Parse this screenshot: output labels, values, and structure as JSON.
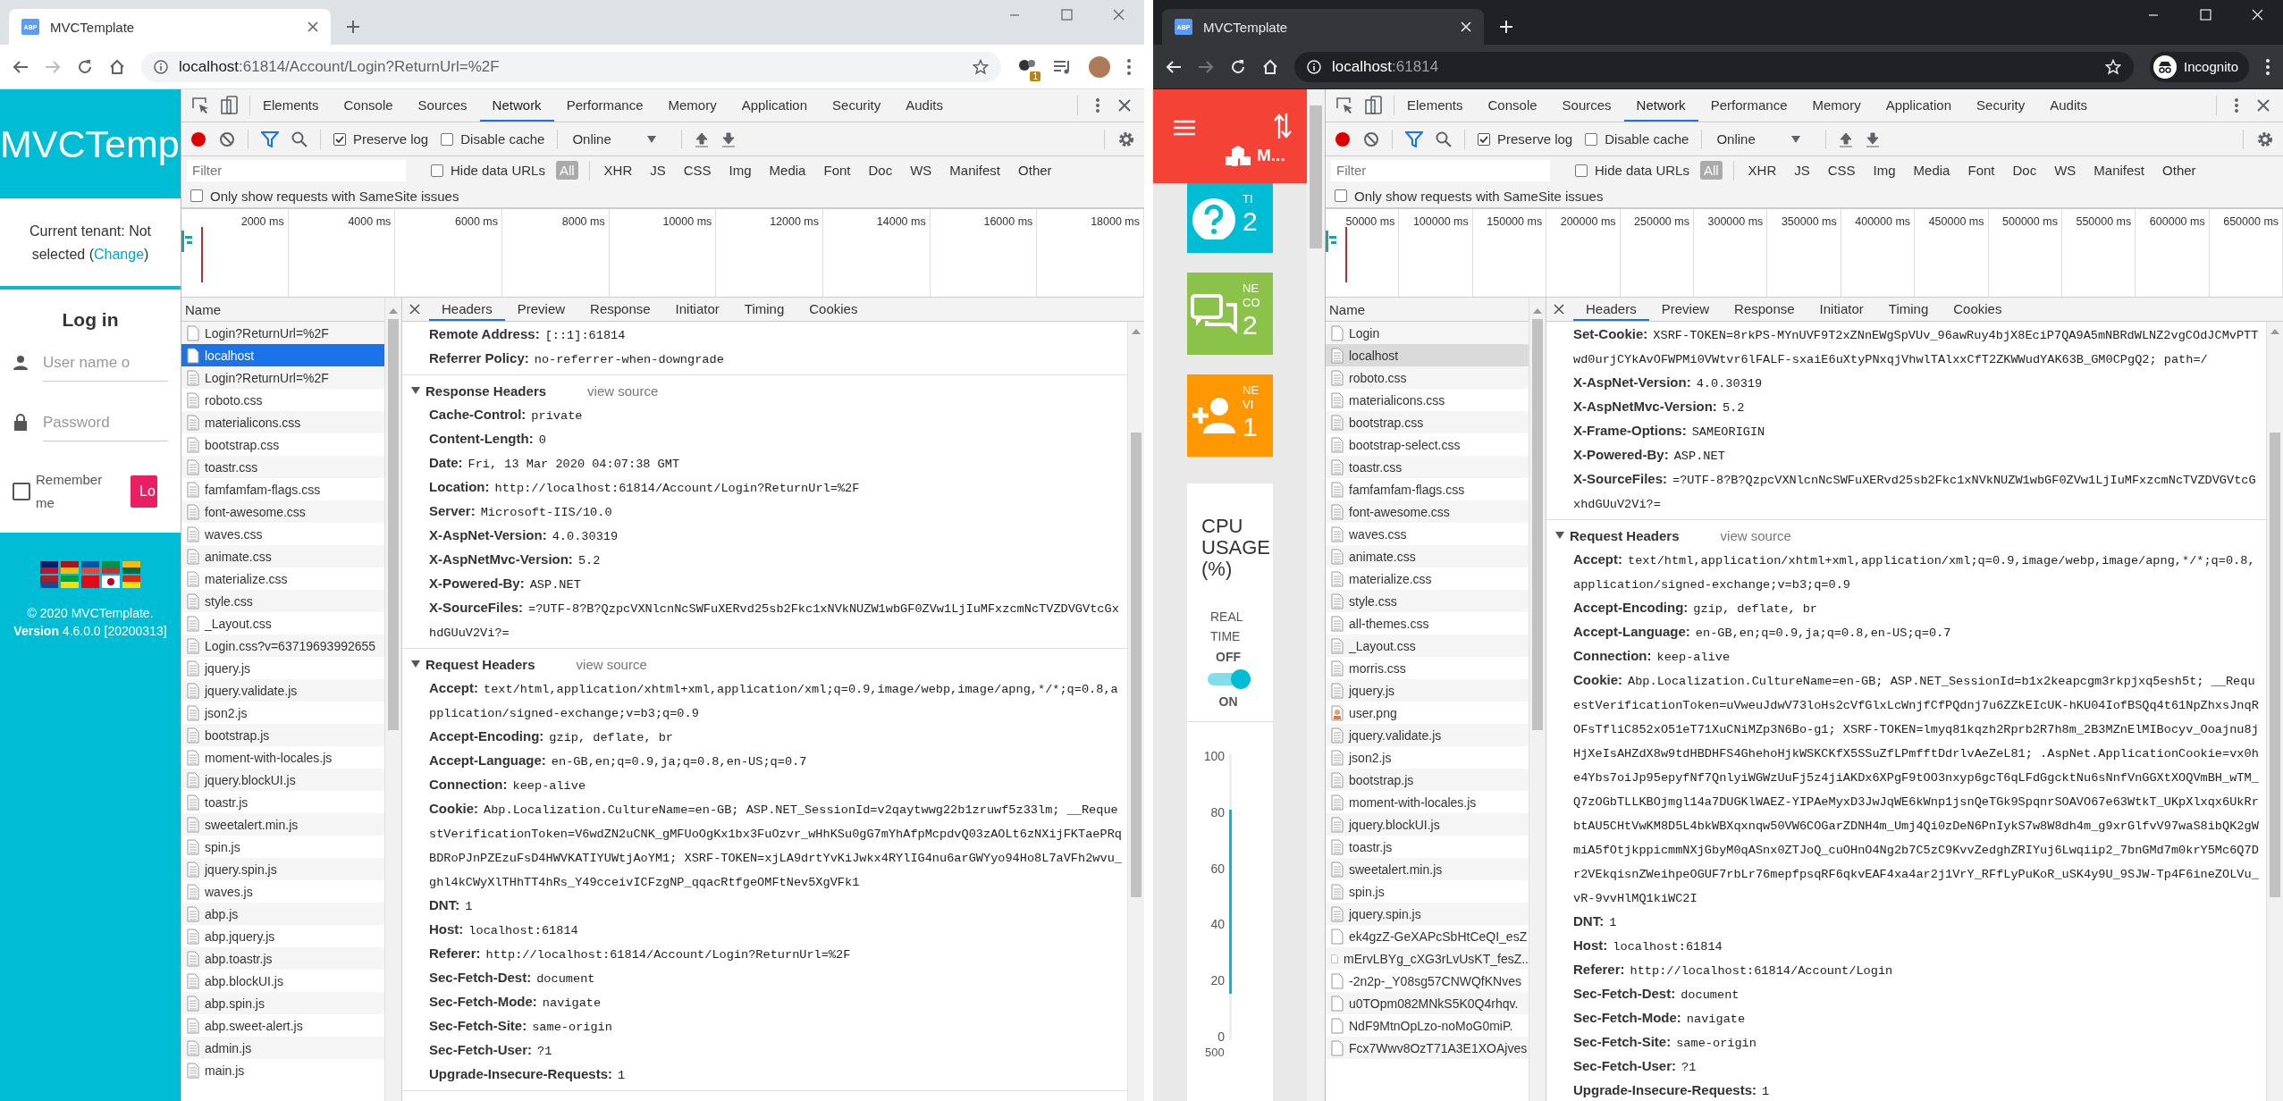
{
  "windows": [
    {
      "incognito": false,
      "tab": {
        "favicon_text": "ABP",
        "title": "MVCTemplate"
      },
      "url_host": "localhost",
      "url_rest": ":61814/Account/Login?ReturnUrl=%2F",
      "extension_badge": "1",
      "app": {
        "kind": "login",
        "brand": "MVCTemp",
        "tenant_prefix": "Current tenant: Not selected (",
        "tenant_link": "Change",
        "tenant_suffix": ")",
        "title": "Log in",
        "username_placeholder": "User name o",
        "password_placeholder": "Password",
        "remember": {
          "label": "Remember me",
          "checked": false
        },
        "login_button": "Lo",
        "copyright": "© 2020 MVCTemplate.",
        "version_label": "Version",
        "version": "4.6.0.0 [20200313]"
      },
      "devtools": {
        "panel_tabs": [
          {
            "label": "Elements",
            "selected": false
          },
          {
            "label": "Console",
            "selected": false
          },
          {
            "label": "Sources",
            "selected": false
          },
          {
            "label": "Network",
            "selected": true
          },
          {
            "label": "Performance",
            "selected": false
          },
          {
            "label": "Memory",
            "selected": false
          },
          {
            "label": "Application",
            "selected": false
          },
          {
            "label": "Security",
            "selected": false
          },
          {
            "label": "Audits",
            "selected": false
          }
        ],
        "preserve_log": {
          "label": "Preserve log",
          "checked": true
        },
        "disable_cache": {
          "label": "Disable cache",
          "checked": false
        },
        "throttling": "Online",
        "filter_placeholder": "Filter",
        "hide_data_urls": {
          "label": "Hide data URLs",
          "checked": false
        },
        "type_filters": [
          {
            "label": "All",
            "selected": true
          },
          {
            "label": "XHR",
            "selected": false
          },
          {
            "label": "JS",
            "selected": false
          },
          {
            "label": "CSS",
            "selected": false
          },
          {
            "label": "Img",
            "selected": false
          },
          {
            "label": "Media",
            "selected": false
          },
          {
            "label": "Font",
            "selected": false
          },
          {
            "label": "Doc",
            "selected": false
          },
          {
            "label": "WS",
            "selected": false
          },
          {
            "label": "Manifest",
            "selected": false
          },
          {
            "label": "Other",
            "selected": false
          }
        ],
        "samesite": {
          "label": "Only show requests with SameSite issues",
          "checked": false
        },
        "timeline_ticks": [
          "2000 ms",
          "4000 ms",
          "6000 ms",
          "8000 ms",
          "10000 ms",
          "12000 ms",
          "14000 ms",
          "16000 ms",
          "18000 ms"
        ],
        "name_header": "Name",
        "list_focused": true,
        "requests": [
          {
            "name": "Login?ReturnUrl=%2F",
            "kind": "document",
            "selected": false
          },
          {
            "name": "localhost",
            "kind": "document",
            "selected": true
          },
          {
            "name": "Login?ReturnUrl=%2F",
            "kind": "file",
            "selected": false
          },
          {
            "name": "roboto.css",
            "kind": "file",
            "selected": false
          },
          {
            "name": "materialicons.css",
            "kind": "file",
            "selected": false
          },
          {
            "name": "bootstrap.css",
            "kind": "file",
            "selected": false
          },
          {
            "name": "toastr.css",
            "kind": "file",
            "selected": false
          },
          {
            "name": "famfamfam-flags.css",
            "kind": "file",
            "selected": false
          },
          {
            "name": "font-awesome.css",
            "kind": "file",
            "selected": false
          },
          {
            "name": "waves.css",
            "kind": "file",
            "selected": false
          },
          {
            "name": "animate.css",
            "kind": "file",
            "selected": false
          },
          {
            "name": "materialize.css",
            "kind": "file",
            "selected": false
          },
          {
            "name": "style.css",
            "kind": "file",
            "selected": false
          },
          {
            "name": "_Layout.css",
            "kind": "file",
            "selected": false
          },
          {
            "name": "Login.css?v=63719693992655",
            "kind": "file",
            "selected": false
          },
          {
            "name": "jquery.js",
            "kind": "file",
            "selected": false
          },
          {
            "name": "jquery.validate.js",
            "kind": "file",
            "selected": false
          },
          {
            "name": "json2.js",
            "kind": "file",
            "selected": false
          },
          {
            "name": "bootstrap.js",
            "kind": "file",
            "selected": false
          },
          {
            "name": "moment-with-locales.js",
            "kind": "file",
            "selected": false
          },
          {
            "name": "jquery.blockUI.js",
            "kind": "file",
            "selected": false
          },
          {
            "name": "toastr.js",
            "kind": "file",
            "selected": false
          },
          {
            "name": "sweetalert.min.js",
            "kind": "file",
            "selected": false
          },
          {
            "name": "spin.js",
            "kind": "file",
            "selected": false
          },
          {
            "name": "jquery.spin.js",
            "kind": "file",
            "selected": false
          },
          {
            "name": "waves.js",
            "kind": "file",
            "selected": false
          },
          {
            "name": "abp.js",
            "kind": "file",
            "selected": false
          },
          {
            "name": "abp.jquery.js",
            "kind": "file",
            "selected": false
          },
          {
            "name": "abp.toastr.js",
            "kind": "file",
            "selected": false
          },
          {
            "name": "abp.blockUI.js",
            "kind": "file",
            "selected": false
          },
          {
            "name": "abp.spin.js",
            "kind": "file",
            "selected": false
          },
          {
            "name": "abp.sweet-alert.js",
            "kind": "file",
            "selected": false
          },
          {
            "name": "admin.js",
            "kind": "file",
            "selected": false
          },
          {
            "name": "main.js",
            "kind": "file",
            "selected": false
          }
        ],
        "detail_tabs": [
          {
            "label": "Headers",
            "selected": true
          },
          {
            "label": "Preview",
            "selected": false
          },
          {
            "label": "Response",
            "selected": false
          },
          {
            "label": "Initiator",
            "selected": false
          },
          {
            "label": "Timing",
            "selected": false
          },
          {
            "label": "Cookies",
            "selected": false
          }
        ],
        "sections": [
          {
            "headers": [
              {
                "name": "Remote Address:",
                "value": "[::1]:61814"
              },
              {
                "name": "Referrer Policy:",
                "value": "no-referrer-when-downgrade"
              }
            ]
          },
          {
            "title": "Response Headers",
            "view_source": "view source",
            "headers": [
              {
                "name": "Cache-Control:",
                "value": "private"
              },
              {
                "name": "Content-Length:",
                "value": "0"
              },
              {
                "name": "Date:",
                "value": "Fri, 13 Mar 2020 04:07:38 GMT"
              },
              {
                "name": "Location:",
                "value": "http://localhost:61814/Account/Login?ReturnUrl=%2F"
              },
              {
                "name": "Server:",
                "value": "Microsoft-IIS/10.0"
              },
              {
                "name": "X-AspNet-Version:",
                "value": "4.0.30319"
              },
              {
                "name": "X-AspNetMvc-Version:",
                "value": "5.2"
              },
              {
                "name": "X-Powered-By:",
                "value": "ASP.NET"
              },
              {
                "name": "X-SourceFiles:",
                "value": "=?UTF-8?B?QzpcVXNlcnNcSWFuXERvd25sb2Fkc1xNVkNUZW1wbGF0ZVw1LjIuMFxzcmNcTVZDVGVtcGxhdGUuV2Vi?="
              }
            ]
          },
          {
            "title": "Request Headers",
            "view_source": "view source",
            "headers": [
              {
                "name": "Accept:",
                "value": "text/html,application/xhtml+xml,application/xml;q=0.9,image/webp,image/apng,*/*;q=0.8,application/signed-exchange;v=b3;q=0.9"
              },
              {
                "name": "Accept-Encoding:",
                "value": "gzip, deflate, br"
              },
              {
                "name": "Accept-Language:",
                "value": "en-GB,en;q=0.9,ja;q=0.8,en-US;q=0.7"
              },
              {
                "name": "Connection:",
                "value": "keep-alive"
              },
              {
                "name": "Cookie:",
                "value": "Abp.Localization.CultureName=en-GB; ASP.NET_SessionId=v2qaytwwg22b1zruwf5z33lm; __RequestVerificationToken=V6wdZN2uCNK_gMFUoOgKx1bx3FuOzvr_wHhKSu0gG7mYhAfpMcpdvQ03zAOLt6zNXijFKTaePRqBDRoPJnPZEzuFsD4HWVKATIYUWtjAoYM1; XSRF-TOKEN=xjLA9drtYvKiJwkx4RYlIG4nu6arGWYyo94Ho8L7aVFh2wvu_ghl4kCWyXlTHhTT4hRs_Y49cceivICFzgNP_qqacRtfgeOMFtNev5XgVFk1"
              },
              {
                "name": "DNT:",
                "value": "1"
              },
              {
                "name": "Host:",
                "value": "localhost:61814"
              },
              {
                "name": "Referer:",
                "value": "http://localhost:61814/Account/Login?ReturnUrl=%2F"
              },
              {
                "name": "Sec-Fetch-Dest:",
                "value": "document"
              },
              {
                "name": "Sec-Fetch-Mode:",
                "value": "navigate"
              },
              {
                "name": "Sec-Fetch-Site:",
                "value": "same-origin"
              },
              {
                "name": "Sec-Fetch-User:",
                "value": "?1"
              },
              {
                "name": "Upgrade-Insecure-Requests:",
                "value": "1"
              }
            ]
          }
        ]
      }
    },
    {
      "incognito": true,
      "tab": {
        "favicon_text": "ABP",
        "title": "MVCTemplate"
      },
      "url_host": "localhost",
      "url_rest": ":61814",
      "profile_label": "Incognito",
      "app": {
        "kind": "dashboard",
        "brand": "M...",
        "tiles": [
          {
            "kind": "question",
            "color": "#00bcd4",
            "lines": [
              "TI"
            ],
            "value": "2"
          },
          {
            "kind": "chat",
            "color": "#8bc34a",
            "lines": [
              "NE",
              "CO"
            ],
            "value": "2"
          },
          {
            "kind": "person-add",
            "color": "#ff9800",
            "lines": [
              "NE",
              "VI"
            ],
            "value": "1"
          }
        ],
        "cpu": {
          "title": "CPU USAGE (%)",
          "realtime": "REAL TIME",
          "off": "OFF",
          "on": "ON",
          "switch_on": true,
          "y_ticks": [
            "100",
            "80",
            "60",
            "40",
            "20",
            "0"
          ],
          "x_tick": "500"
        }
      },
      "devtools": {
        "panel_tabs": [
          {
            "label": "Elements",
            "selected": false
          },
          {
            "label": "Console",
            "selected": false
          },
          {
            "label": "Sources",
            "selected": false
          },
          {
            "label": "Network",
            "selected": true
          },
          {
            "label": "Performance",
            "selected": false
          },
          {
            "label": "Memory",
            "selected": false
          },
          {
            "label": "Application",
            "selected": false
          },
          {
            "label": "Security",
            "selected": false
          },
          {
            "label": "Audits",
            "selected": false
          }
        ],
        "preserve_log": {
          "label": "Preserve log",
          "checked": true
        },
        "disable_cache": {
          "label": "Disable cache",
          "checked": false
        },
        "throttling": "Online",
        "filter_placeholder": "Filter",
        "hide_data_urls": {
          "label": "Hide data URLs",
          "checked": false
        },
        "type_filters": [
          {
            "label": "All",
            "selected": true
          },
          {
            "label": "XHR",
            "selected": false
          },
          {
            "label": "JS",
            "selected": false
          },
          {
            "label": "CSS",
            "selected": false
          },
          {
            "label": "Img",
            "selected": false
          },
          {
            "label": "Media",
            "selected": false
          },
          {
            "label": "Font",
            "selected": false
          },
          {
            "label": "Doc",
            "selected": false
          },
          {
            "label": "WS",
            "selected": false
          },
          {
            "label": "Manifest",
            "selected": false
          },
          {
            "label": "Other",
            "selected": false
          }
        ],
        "samesite": {
          "label": "Only show requests with SameSite issues",
          "checked": false
        },
        "timeline_ticks": [
          "50000 ms",
          "100000 ms",
          "150000 ms",
          "200000 ms",
          "250000 ms",
          "300000 ms",
          "350000 ms",
          "400000 ms",
          "450000 ms",
          "500000 ms",
          "550000 ms",
          "600000 ms",
          "650000 ms"
        ],
        "name_header": "Name",
        "list_focused": false,
        "requests": [
          {
            "name": "Login",
            "kind": "document",
            "selected": false
          },
          {
            "name": "localhost",
            "kind": "file",
            "selected": true
          },
          {
            "name": "roboto.css",
            "kind": "file",
            "selected": false
          },
          {
            "name": "materialicons.css",
            "kind": "file",
            "selected": false
          },
          {
            "name": "bootstrap.css",
            "kind": "file",
            "selected": false
          },
          {
            "name": "bootstrap-select.css",
            "kind": "file",
            "selected": false
          },
          {
            "name": "toastr.css",
            "kind": "file",
            "selected": false
          },
          {
            "name": "famfamfam-flags.css",
            "kind": "file",
            "selected": false
          },
          {
            "name": "font-awesome.css",
            "kind": "file",
            "selected": false
          },
          {
            "name": "waves.css",
            "kind": "file",
            "selected": false
          },
          {
            "name": "animate.css",
            "kind": "file",
            "selected": false
          },
          {
            "name": "materialize.css",
            "kind": "file",
            "selected": false
          },
          {
            "name": "style.css",
            "kind": "file",
            "selected": false
          },
          {
            "name": "all-themes.css",
            "kind": "file",
            "selected": false
          },
          {
            "name": "_Layout.css",
            "kind": "file",
            "selected": false
          },
          {
            "name": "morris.css",
            "kind": "file",
            "selected": false
          },
          {
            "name": "jquery.js",
            "kind": "file",
            "selected": false
          },
          {
            "name": "user.png",
            "kind": "image",
            "selected": false
          },
          {
            "name": "jquery.validate.js",
            "kind": "file",
            "selected": false
          },
          {
            "name": "json2.js",
            "kind": "file",
            "selected": false
          },
          {
            "name": "bootstrap.js",
            "kind": "file",
            "selected": false
          },
          {
            "name": "moment-with-locales.js",
            "kind": "file",
            "selected": false
          },
          {
            "name": "jquery.blockUI.js",
            "kind": "file",
            "selected": false
          },
          {
            "name": "toastr.js",
            "kind": "file",
            "selected": false
          },
          {
            "name": "sweetalert.min.js",
            "kind": "file",
            "selected": false
          },
          {
            "name": "spin.js",
            "kind": "file",
            "selected": false
          },
          {
            "name": "jquery.spin.js",
            "kind": "file",
            "selected": false
          },
          {
            "name": "ek4gzZ-GeXAPcSbHtCeQI_esZ",
            "kind": "document",
            "selected": false
          },
          {
            "name": "mErvLBYg_cXG3rLvUsKT_fesZ..",
            "kind": "document",
            "selected": false
          },
          {
            "name": "-2n2p-_Y08sg57CNWQfKNves",
            "kind": "document",
            "selected": false
          },
          {
            "name": "u0TOpm082MNkS5K0Q4rhqv.",
            "kind": "document",
            "selected": false
          },
          {
            "name": "NdF9MtnOpLzo-noMoG0miP.",
            "kind": "document",
            "selected": false
          },
          {
            "name": "Fcx7Wwv8OzT71A3E1XOAjves",
            "kind": "document",
            "selected": false
          }
        ],
        "detail_tabs": [
          {
            "label": "Headers",
            "selected": true
          },
          {
            "label": "Preview",
            "selected": false
          },
          {
            "label": "Response",
            "selected": false
          },
          {
            "label": "Initiator",
            "selected": false
          },
          {
            "label": "Timing",
            "selected": false
          },
          {
            "label": "Cookies",
            "selected": false
          }
        ],
        "sections": [
          {
            "headers": [
              {
                "name": "Set-Cookie:",
                "value": "XSRF-TOKEN=8rkPS-MYnUVF9T2xZNnEWgSpVUv_96awRuy4bjX8EciP7QA9A5mNBRdWLNZ2vgCOdJCMvPTTwd0urjCYkAvOFWPMi0VWtvr6lFALF-sxaiE6uXtyPNxqjVhwlTAlxxCfT2ZKWWudYAK63B_GM0CPgQ2; path=/"
              },
              {
                "name": "X-AspNet-Version:",
                "value": "4.0.30319"
              },
              {
                "name": "X-AspNetMvc-Version:",
                "value": "5.2"
              },
              {
                "name": "X-Frame-Options:",
                "value": "SAMEORIGIN"
              },
              {
                "name": "X-Powered-By:",
                "value": "ASP.NET"
              },
              {
                "name": "X-SourceFiles:",
                "value": "=?UTF-8?B?QzpcVXNlcnNcSWFuXERvd25sb2Fkc1xNVkNUZW1wbGF0ZVw1LjIuMFxzcmNcTVZDVGVtcGxhdGUuV2Vi?="
              }
            ]
          },
          {
            "title": "Request Headers",
            "view_source": "view source",
            "headers": [
              {
                "name": "Accept:",
                "value": "text/html,application/xhtml+xml,application/xml;q=0.9,image/webp,image/apng,*/*;q=0.8,application/signed-exchange;v=b3;q=0.9"
              },
              {
                "name": "Accept-Encoding:",
                "value": "gzip, deflate, br"
              },
              {
                "name": "Accept-Language:",
                "value": "en-GB,en;q=0.9,ja;q=0.8,en-US;q=0.7"
              },
              {
                "name": "Connection:",
                "value": "keep-alive"
              },
              {
                "name": "Cookie:",
                "value": "Abp.Localization.CultureName=en-GB; ASP.NET_SessionId=b1x2keapcgm3rkpjxq5esh5t; __RequestVerificationToken=uVweuJdwV73loHs2cVfGlxLcWnjfCfPQdnj7u6ZZkEIcUK-hKU04IofBSQq4t61NpZhxsJnqROFsTfliC852xO51eT71XuCNiMZp3N6Bo-g1; XSRF-TOKEN=lmyq81kqzh2Rprb2R7h8m_2B3MZnElMIBocyv_Ooajnu8jHjXeIsAHZdX8w9tdHBDHFS4GhehoHjkWSKCKfX5SSuZfLPmfftDdrlvAeZeL81; .AspNet.ApplicationCookie=vx0he4Ybs7oiJp95epyfNf7QnlyiWGWzUuFj5z4jiAKDx6XPgF9tOO3nxyp6gcT6qLFdGgcktNu6sNnfVnGGXtXOQVmBH_wTM_Q7zOGbTLLKBOjmgl14a7DUGKlWAEZ-YIPAeMyxD3JwJqWE6kWnp1jsnQeTGk9SpqnrSOAVO67e63WtkT_UKpXlxqx6UkRrbtAU5CHtVwKM8D5L4bkWBXqxnqw50VW6COGarZDNH4m_Umj4Qi0zDeN6PnIykS7w8W8dh4m_g9xrGlfvV97waS8ibQK2gWmiA5fOtjkppicmmNXjGbyM0qASnx0ZTJoQ_cuOHnO4Ng2b7C5zC9KvvZedghZRIYuj6Lwqiip2_7bnGMd7m0krY5Mc6Q7Dr2VEkqisnZWeihpeOGUF7rbLr76mepfpsqRF6qkvEAF4xa4ar2j1VrY_RFfLyPuKoR_uSK4y9U_9SJW-Tp4F6ineZOLVu_vR-9vvHlMQ1kiWC2I"
              },
              {
                "name": "DNT:",
                "value": "1"
              },
              {
                "name": "Host:",
                "value": "localhost:61814"
              },
              {
                "name": "Referer:",
                "value": "http://localhost:61814/Account/Login"
              },
              {
                "name": "Sec-Fetch-Dest:",
                "value": "document"
              },
              {
                "name": "Sec-Fetch-Mode:",
                "value": "navigate"
              },
              {
                "name": "Sec-Fetch-Site:",
                "value": "same-origin"
              },
              {
                "name": "Sec-Fetch-User:",
                "value": "?1"
              },
              {
                "name": "Upgrade-Insecure-Requests:",
                "value": "1"
              }
            ]
          }
        ]
      }
    }
  ]
}
